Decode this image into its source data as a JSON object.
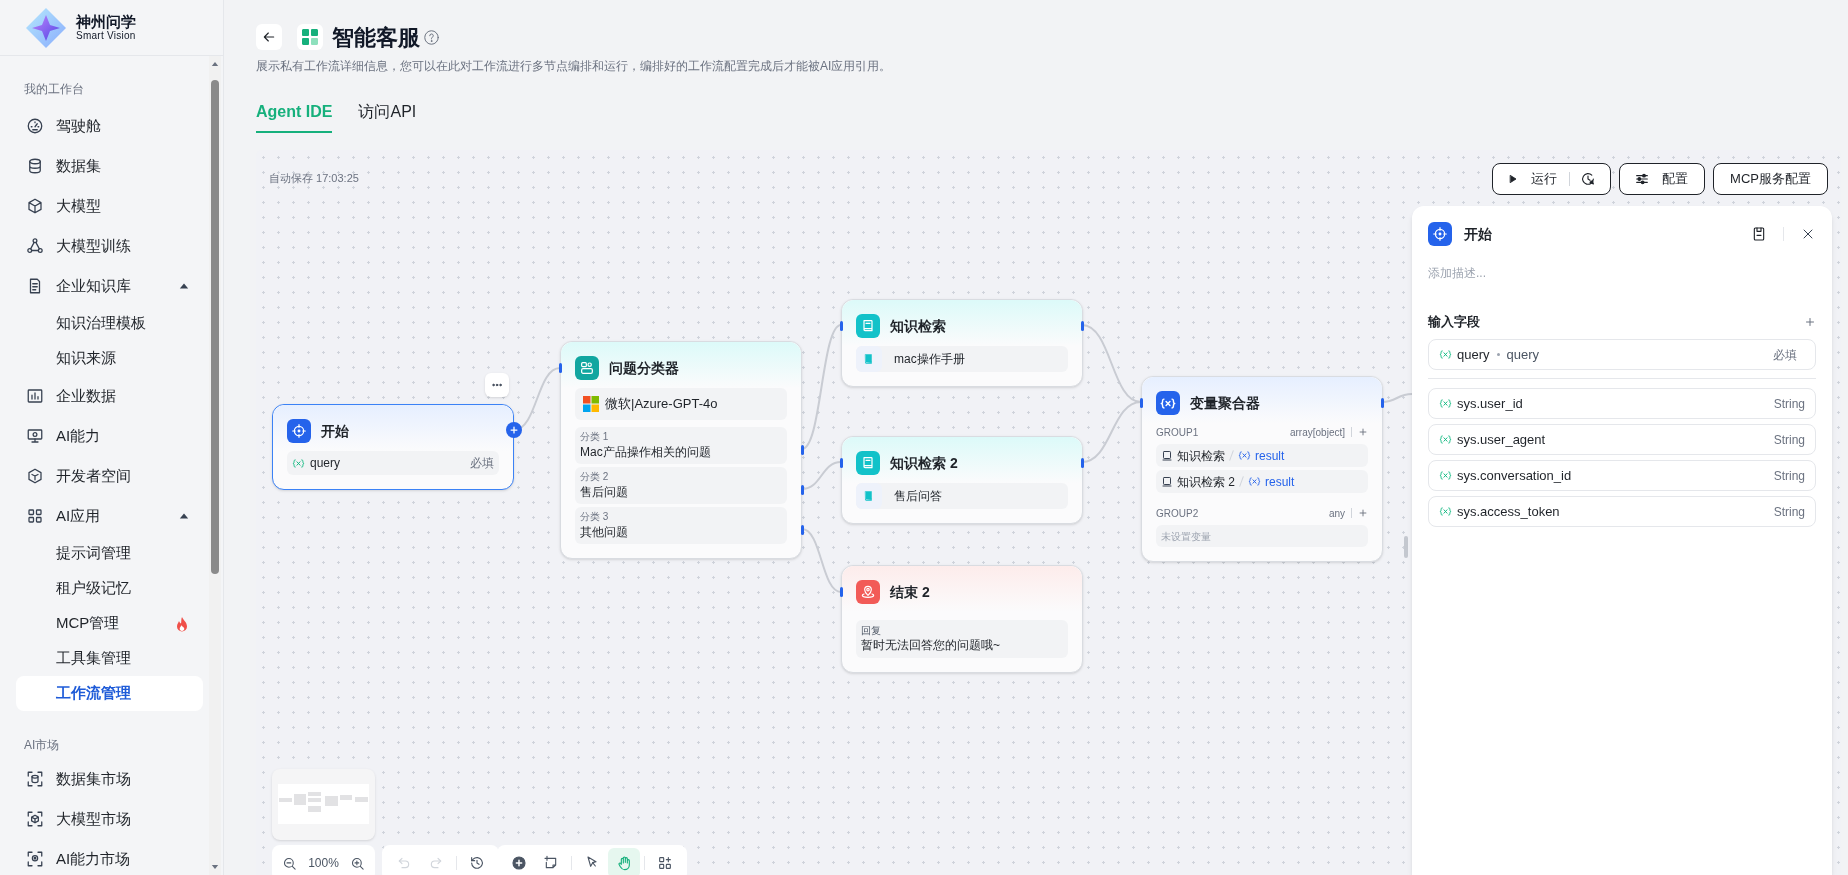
{
  "sidebar": {
    "brand": {
      "name": "神州问学",
      "tagline": "Smart Vision"
    },
    "sections": [
      {
        "title": "我的工作台",
        "items": [
          {
            "label": "驾驶舱",
            "selected": false
          },
          {
            "label": "数据集",
            "selected": false
          },
          {
            "label": "大模型",
            "selected": false
          },
          {
            "label": "大模型训练",
            "selected": false
          },
          {
            "label": "企业知识库",
            "selected": false,
            "expanded": true,
            "children": [
              {
                "label": "知识治理模板",
                "selected": false,
                "hot": false
              },
              {
                "label": "知识来源",
                "selected": false,
                "hot": false
              }
            ]
          },
          {
            "label": "企业数据",
            "selected": false
          },
          {
            "label": "AI能力",
            "selected": false
          },
          {
            "label": "开发者空间",
            "selected": false
          },
          {
            "label": "AI应用",
            "selected": false,
            "expanded": true,
            "children": [
              {
                "label": "提示词管理",
                "selected": false,
                "hot": false
              },
              {
                "label": "租户级记忆",
                "selected": false,
                "hot": false
              },
              {
                "label": "MCP管理",
                "selected": false,
                "hot": true
              },
              {
                "label": "工具集管理",
                "selected": false,
                "hot": false
              },
              {
                "label": "工作流管理",
                "selected": true,
                "hot": false
              }
            ]
          }
        ]
      },
      {
        "title": "AI市场",
        "items": [
          {
            "label": "数据集市场",
            "selected": false
          },
          {
            "label": "大模型市场",
            "selected": false
          },
          {
            "label": "AI能力市场",
            "selected": false
          }
        ]
      }
    ]
  },
  "header": {
    "title": "智能客服",
    "description": "展示私有工作流详细信息，您可以在此对工作流进行多节点编排和运行，编排好的工作流配置完成后才能被AI应用引用。"
  },
  "tabs": [
    {
      "label": "Agent IDE",
      "selected": true
    },
    {
      "label": "访问API",
      "selected": false
    }
  ],
  "canvas": {
    "autosave": "自动保存 17:03:25",
    "toolbar": [
      {
        "kind": "run",
        "label": "运行"
      },
      {
        "kind": "config",
        "label": "配置"
      },
      {
        "kind": "mcp",
        "label": "MCP服务配置"
      }
    ],
    "nodes": [
      {
        "kind": "start",
        "title": "开始",
        "selected": true,
        "fields": [
          {
            "name": "query",
            "required": "必填"
          }
        ]
      },
      {
        "kind": "classifier",
        "title": "问题分类器",
        "selected": false,
        "model": "微软|Azure-GPT-4o",
        "classes": [
          {
            "label": "分类 1",
            "text": "Mac产品操作相关的问题"
          },
          {
            "label": "分类 2",
            "text": "售后问题"
          },
          {
            "label": "分类 3",
            "text": "其他问题"
          }
        ]
      },
      {
        "kind": "knowledge",
        "title": "知识检索",
        "selected": false,
        "datasets": [
          "mac操作手册"
        ]
      },
      {
        "kind": "knowledge",
        "title": "知识检索 2",
        "selected": false,
        "datasets": [
          "售后问答"
        ]
      },
      {
        "kind": "end",
        "title": "结束 2",
        "selected": false,
        "reply_label": "回复",
        "reply": "暂时无法回答您的问题哦~"
      },
      {
        "kind": "aggregator",
        "title": "变量聚合器",
        "selected": false,
        "groups": [
          {
            "name": "GROUP1",
            "type": "array[object]",
            "vars": [
              {
                "node": "知识检索",
                "var": "result"
              },
              {
                "node": "知识检索 2",
                "var": "result"
              }
            ]
          },
          {
            "name": "GROUP2",
            "type": "any",
            "placeholder": "未设置变量"
          }
        ]
      }
    ],
    "panel": {
      "title": "开始",
      "description_placeholder": "添加描述...",
      "section": "输入字段",
      "inputs": [
        {
          "name": "query",
          "label": "query",
          "required": "必填"
        }
      ],
      "system_vars": [
        {
          "name": "sys.user_id",
          "type": "String"
        },
        {
          "name": "sys.user_agent",
          "type": "String"
        },
        {
          "name": "sys.conversation_id",
          "type": "String"
        },
        {
          "name": "sys.access_token",
          "type": "String"
        }
      ]
    },
    "zoom": "100%",
    "history_tools": [
      {
        "items": [
          {
            "kind": "undo",
            "disabled": true
          },
          {
            "kind": "redo",
            "disabled": true
          }
        ]
      },
      {
        "items": [
          {
            "kind": "history",
            "disabled": false
          }
        ]
      }
    ],
    "edit_tools": [
      {
        "items": [
          {
            "kind": "add",
            "selected": false
          },
          {
            "kind": "note",
            "selected": false
          }
        ]
      },
      {
        "items": [
          {
            "kind": "pointer",
            "selected": false
          },
          {
            "kind": "hand",
            "selected": true
          }
        ]
      },
      {
        "items": [
          {
            "kind": "layout",
            "selected": false
          }
        ]
      }
    ]
  }
}
